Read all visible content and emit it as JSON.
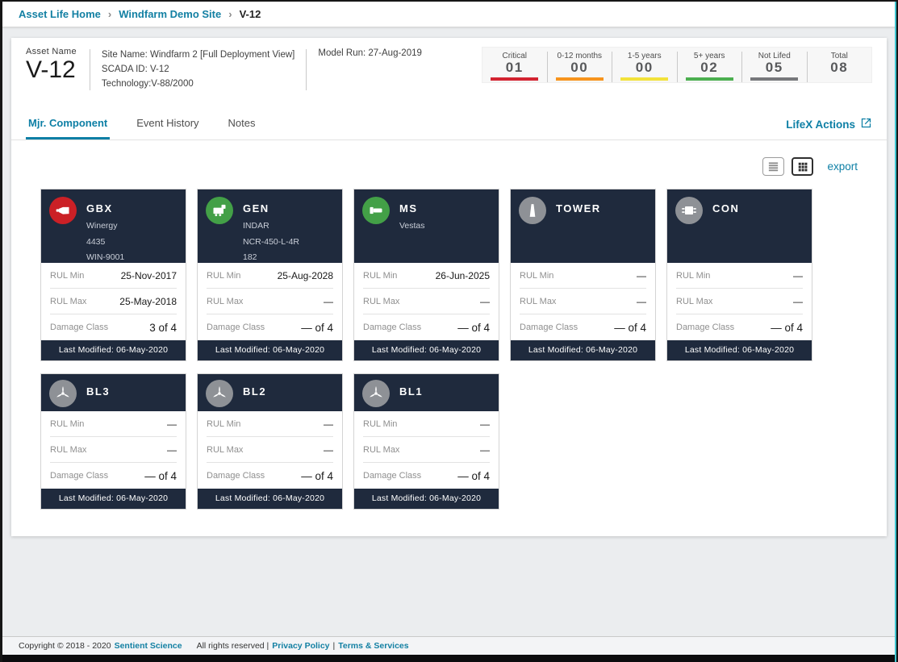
{
  "colors": {
    "accent_teal": "#0d7fa5",
    "navy": "#1f2a3d",
    "critical_red": "#d32330",
    "orange": "#f7941d",
    "yellow": "#f2e23a",
    "green": "#4caf50",
    "gray": "#77787b"
  },
  "breadcrumb": {
    "separator": "›",
    "items": [
      {
        "label": "Asset Life Home",
        "current": false
      },
      {
        "label": "Windfarm Demo Site",
        "current": false
      },
      {
        "label": "V-12",
        "current": true
      }
    ]
  },
  "header": {
    "asset_name_label": "Asset Name",
    "asset_name": "V-12",
    "site_info": [
      "Site Name: Windfarm 2 [Full Deployment View]",
      "SCADA ID: V-12",
      "Technology:V-88/2000"
    ],
    "model_run": "Model Run: 27-Aug-2019",
    "badges": [
      {
        "label": "Critical",
        "value": "01",
        "color": "#d32330"
      },
      {
        "label": "0-12 months",
        "value": "00",
        "color": "#f7941d"
      },
      {
        "label": "1-5 years",
        "value": "00",
        "color": "#f2e23a"
      },
      {
        "label": "5+ years",
        "value": "02",
        "color": "#4caf50"
      },
      {
        "label": "Not Lifed",
        "value": "05",
        "color": "#77787b"
      },
      {
        "label": "Total",
        "value": "08",
        "color": "transparent"
      }
    ]
  },
  "tabs": [
    {
      "label": "Mjr. Component",
      "active": true
    },
    {
      "label": "Event History",
      "active": false
    },
    {
      "label": "Notes",
      "active": false
    }
  ],
  "lifex": {
    "label": "LifeX Actions",
    "icon": "external-link-icon"
  },
  "toolbar": {
    "list_view_icon": "list-view-icon",
    "grid_view_icon": "grid-view-icon",
    "export_label": "export"
  },
  "card_labels": {
    "rul_min": "RUL Min",
    "rul_max": "RUL Max",
    "damage_class": "Damage Class"
  },
  "cards": [
    {
      "code": "GBX",
      "icon": "gearbox-icon",
      "icon_color": "#cb2026",
      "subtitles": [
        "Winergy",
        "4435",
        "WIN-9001"
      ],
      "rul_min": "25-Nov-2017",
      "rul_max": "25-May-2018",
      "damage_class": "3 of 4",
      "last_modified": "Last Modified: 06-May-2020"
    },
    {
      "code": "GEN",
      "icon": "generator-icon",
      "icon_color": "#43a047",
      "subtitles": [
        "INDAR",
        "NCR-450-L-4R",
        "182"
      ],
      "rul_min": "25-Aug-2028",
      "rul_max": "—",
      "damage_class": "— of 4",
      "last_modified": "Last Modified: 06-May-2020"
    },
    {
      "code": "MS",
      "icon": "main-shaft-icon",
      "icon_color": "#43a047",
      "subtitles": [
        "Vestas"
      ],
      "rul_min": "26-Jun-2025",
      "rul_max": "—",
      "damage_class": "— of 4",
      "last_modified": "Last Modified: 06-May-2020"
    },
    {
      "code": "TOWER",
      "icon": "tower-icon",
      "icon_color": "#8e9196",
      "subtitles": [],
      "rul_min": "—",
      "rul_max": "—",
      "damage_class": "— of 4",
      "last_modified": "Last Modified: 06-May-2020"
    },
    {
      "code": "CON",
      "icon": "converter-icon",
      "icon_color": "#8e9196",
      "subtitles": [],
      "rul_min": "—",
      "rul_max": "—",
      "damage_class": "— of 4",
      "last_modified": "Last Modified: 06-May-2020"
    },
    {
      "code": "BL3",
      "icon": "blade-icon",
      "icon_color": "#8e9196",
      "subtitles": [],
      "rul_min": "—",
      "rul_max": "—",
      "damage_class": "— of 4",
      "last_modified": "Last Modified: 06-May-2020"
    },
    {
      "code": "BL2",
      "icon": "blade-icon",
      "icon_color": "#8e9196",
      "subtitles": [],
      "rul_min": "—",
      "rul_max": "—",
      "damage_class": "— of 4",
      "last_modified": "Last Modified: 06-May-2020"
    },
    {
      "code": "BL1",
      "icon": "blade-icon",
      "icon_color": "#8e9196",
      "subtitles": [],
      "rul_min": "—",
      "rul_max": "—",
      "damage_class": "— of 4",
      "last_modified": "Last Modified: 06-May-2020"
    }
  ],
  "footer": {
    "copyright_prefix": "Copyright © 2018 - 2020",
    "company_link": "Sentient Science",
    "rights_text": "All rights reserved |",
    "privacy_link": "Privacy Policy",
    "separator": "|",
    "terms_link": "Terms & Services"
  }
}
